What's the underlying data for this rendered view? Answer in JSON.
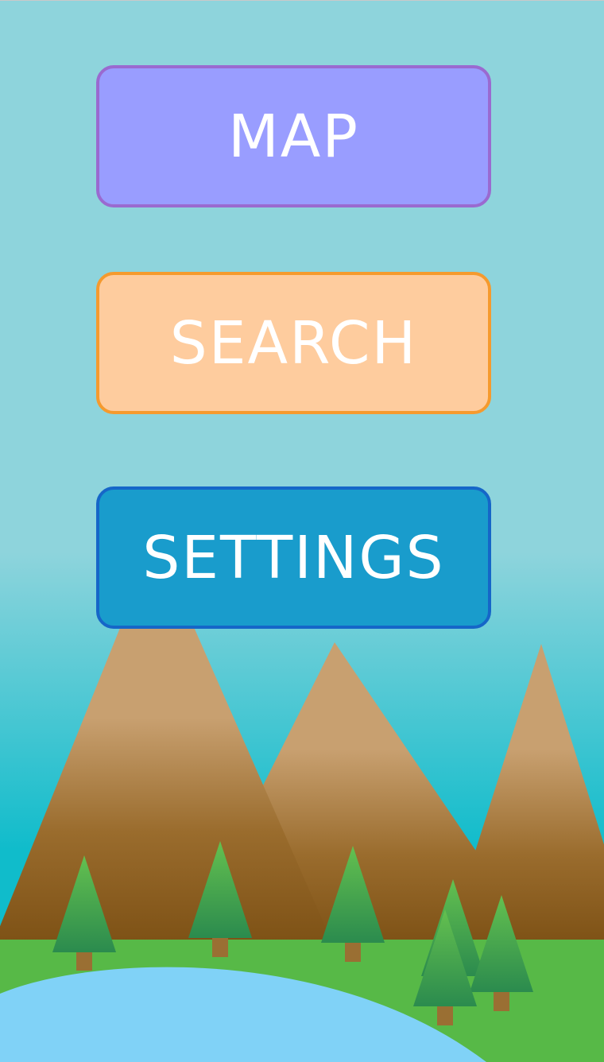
{
  "menu": {
    "buttons": [
      {
        "label": "MAP",
        "background": "#999dff",
        "border": "#9a6ad0"
      },
      {
        "label": "SEARCH",
        "background": "#fecc9e",
        "border": "#f59a2e"
      },
      {
        "label": "SETTINGS",
        "background": "#199ccc",
        "border": "#1566c8"
      }
    ]
  },
  "scene": {
    "sky_top": "#8ed4dc",
    "sky_bottom": "#10bccb",
    "mountain_light": "#c8a070",
    "mountain_dark": "#7d5115",
    "grass": "#57b947",
    "lake": "#80d2f7",
    "tree_light": "#64c04f",
    "tree_dark": "#2b8b4e",
    "trunk": "#9a6f33"
  }
}
